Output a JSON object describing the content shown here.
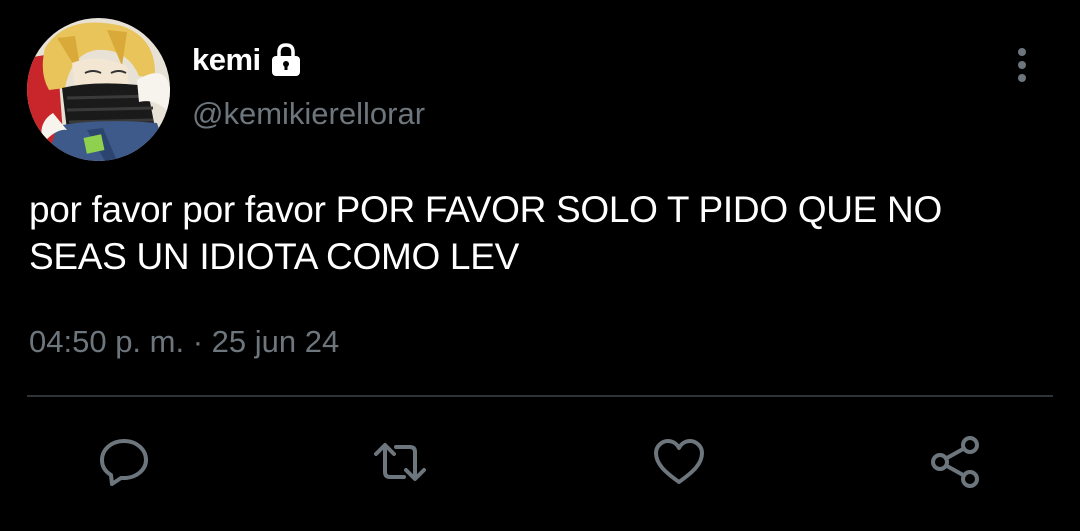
{
  "tweet": {
    "display_name": "kemi",
    "handle": "@kemikierellorar",
    "text_line1": "por favor por favor POR FAVOR SOLO T PIDO QUE NO",
    "text_line2": "SEAS UN IDIOTA COMO LEV",
    "timestamp": "04:50 p. m. · 25 jun 24",
    "protected": true
  },
  "icons": {
    "lock": "lock-icon",
    "more": "more-vertical-icon",
    "reply": "reply-icon",
    "retweet": "retweet-icon",
    "like": "heart-icon",
    "share": "share-icon"
  },
  "colors": {
    "background": "#000000",
    "text_primary": "#ffffff",
    "text_secondary": "#6e767d",
    "divider": "#2f3336"
  }
}
